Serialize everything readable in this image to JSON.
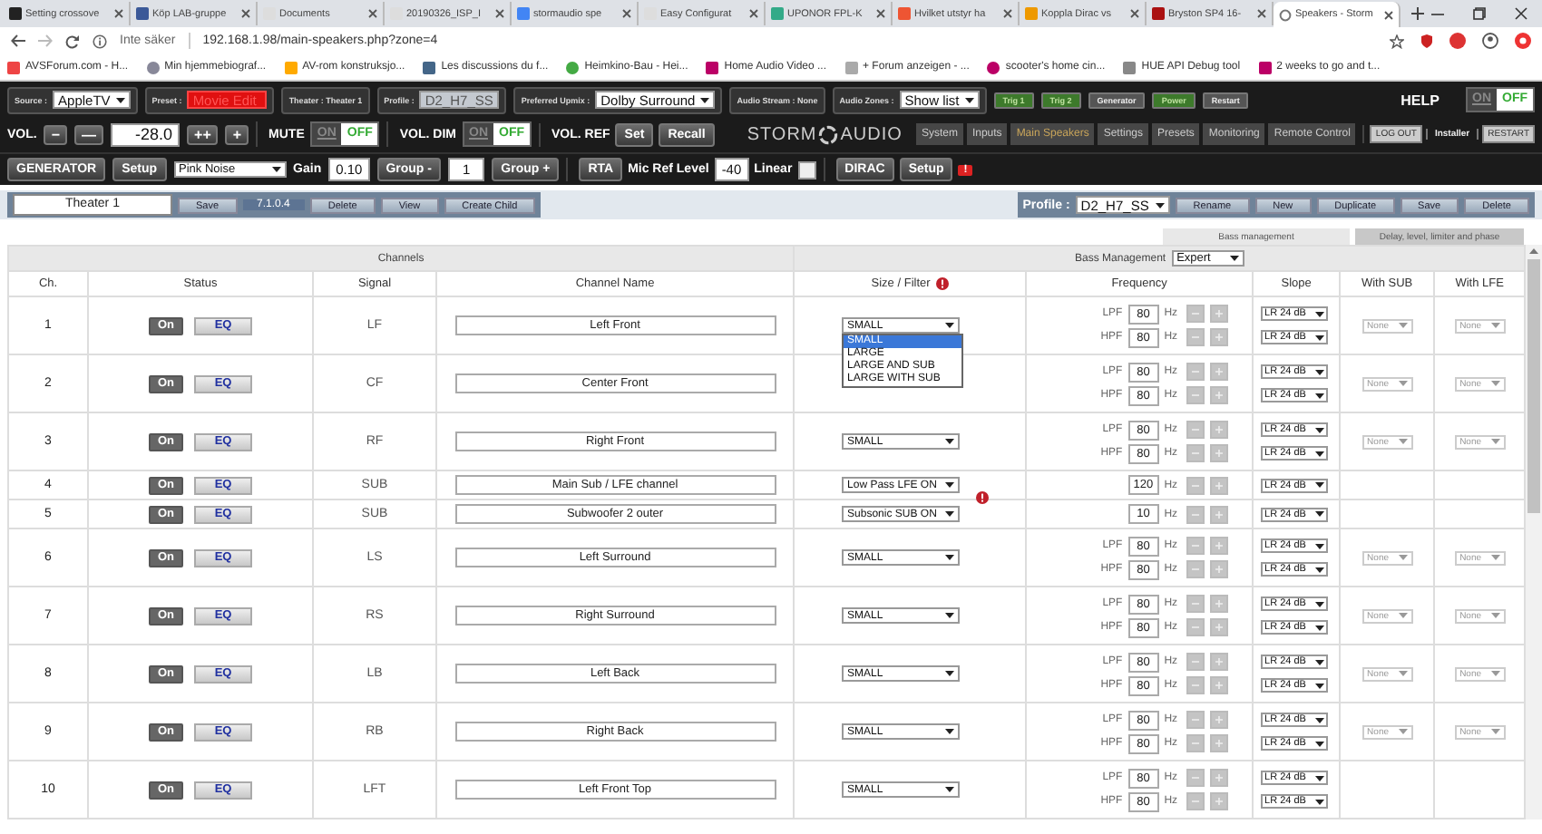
{
  "browser": {
    "tabs": [
      {
        "title": "Setting crossove",
        "selected": false
      },
      {
        "title": "Köp LAB-gruppe",
        "selected": false
      },
      {
        "title": "Documents",
        "selected": false
      },
      {
        "title": "20190326_ISP_I",
        "selected": false
      },
      {
        "title": "stormaudio spe",
        "selected": false
      },
      {
        "title": "Easy Configurat",
        "selected": false
      },
      {
        "title": "UPONOR FPL-K",
        "selected": false
      },
      {
        "title": "Hvilket utstyr ha",
        "selected": false
      },
      {
        "title": "Koppla Dirac vs",
        "selected": false
      },
      {
        "title": "Bryston SP4 16-",
        "selected": false
      },
      {
        "title": "Speakers - Storm",
        "selected": true
      }
    ],
    "address": {
      "security": "Inte säker",
      "url": "192.168.1.98/main-speakers.php?zone=4"
    },
    "bookmarks": [
      "AVSForum.com - H...",
      "Min hjemmebiograf...",
      "AV-rom konstruksjo...",
      "Les discussions du f...",
      "Heimkino-Bau - Hei...",
      "Home Audio Video ...",
      "+ Forum anzeigen - ...",
      "scooter's home cin...",
      "HUE API Debug tool",
      "2 weeks to go and t..."
    ]
  },
  "header": {
    "selectors": [
      {
        "label": "Source :",
        "value": "AppleTV",
        "kind": "select"
      },
      {
        "label": "Preset :",
        "value": "Movie Edit",
        "kind": "alert"
      },
      {
        "label": "Theater : Theater 1",
        "kind": "plain"
      },
      {
        "label": "Profile :",
        "value": "D2_H7_SS",
        "kind": "disabled"
      },
      {
        "label": "Preferred Upmix :",
        "value": "Dolby Surround",
        "kind": "select"
      },
      {
        "label": "Audio Stream : None",
        "kind": "plain"
      },
      {
        "label": "Audio Zones :",
        "value": "Show list",
        "kind": "select"
      }
    ],
    "triggers": [
      {
        "label": "Trig 1",
        "on": true
      },
      {
        "label": "Trig 2",
        "on": true
      },
      {
        "label": "Generator",
        "on": false
      },
      {
        "label": "Power",
        "on": true
      },
      {
        "label": "Restart",
        "on": false
      }
    ],
    "help": {
      "label": "HELP",
      "on_text": "ON",
      "off_text": "OFF",
      "on": false
    }
  },
  "volume": {
    "label": "VOL.",
    "down": [
      "−",
      "—"
    ],
    "value": "-28.0",
    "up": [
      "++",
      "+"
    ]
  },
  "toggles": [
    {
      "label": "MUTE",
      "on_text": "ON",
      "off_text": "OFF",
      "on": false
    },
    {
      "label": "VOL. DIM",
      "on_text": "ON",
      "off_text": "OFF",
      "on": false
    }
  ],
  "vol_ref": {
    "label": "VOL. REF",
    "buttons": [
      "Set",
      "Recall"
    ]
  },
  "logo": {
    "left": "STORM",
    "right": "AUDIO"
  },
  "nav": [
    {
      "label": "System",
      "selected": false
    },
    {
      "label": "Inputs",
      "selected": false
    },
    {
      "label": "Main Speakers",
      "selected": true
    },
    {
      "label": "Settings",
      "selected": false
    },
    {
      "label": "Presets",
      "selected": false
    },
    {
      "label": "Monitoring",
      "selected": false
    },
    {
      "label": "Remote Control",
      "selected": false
    }
  ],
  "session": {
    "logout": "LOG OUT",
    "user": "Installer",
    "restart": "RESTART"
  },
  "generator": {
    "label": "GENERATOR",
    "setup": "Setup",
    "signal": "Pink Noise",
    "gain_label": "Gain",
    "gain": "0.10",
    "group_minus": "Group -",
    "group": "1",
    "group_plus": "Group +"
  },
  "rta": {
    "label": "RTA",
    "mic_label": "Mic Ref Level",
    "mic": "-40",
    "linear_label": "Linear",
    "linear": false
  },
  "dirac": {
    "label": "DIRAC",
    "setup": "Setup",
    "alert": "!"
  },
  "theater_bar": {
    "name": "Theater 1",
    "actions": [
      {
        "label": "Save",
        "kind": "button"
      },
      {
        "label": "7.1.0.4",
        "kind": "info"
      },
      {
        "label": "Delete",
        "kind": "button"
      },
      {
        "label": "View",
        "kind": "button"
      },
      {
        "label": "Create Child",
        "kind": "button"
      }
    ]
  },
  "profile_bar": {
    "label": "Profile :",
    "value": "D2_H7_SS",
    "actions": [
      "Rename",
      "New",
      "Duplicate",
      "Save",
      "Delete"
    ]
  },
  "section_tabs": [
    {
      "label": "Bass management",
      "selected": true
    },
    {
      "label": "Delay, level, limiter and phase",
      "selected": false
    }
  ],
  "table": {
    "group_title": "Channels",
    "bass_label": "Bass Management",
    "bass_mode": "Expert",
    "columns": [
      {
        "label": "Ch."
      },
      {
        "label": "Status"
      },
      {
        "label": "Signal"
      },
      {
        "label": "Channel Name"
      },
      {
        "label": "Size / Filter",
        "warning": true
      },
      {
        "label": "Frequency"
      },
      {
        "label": "Slope"
      },
      {
        "label": "With SUB"
      },
      {
        "label": "With LFE"
      }
    ],
    "rows": [
      {
        "ch": "1",
        "kind": "speaker",
        "on": "On",
        "eq": "EQ",
        "signal": "LF",
        "name": "Left Front",
        "size": "SMALL",
        "options": [
          {
            "label": "SMALL",
            "selected": true
          },
          {
            "label": "LARGE",
            "selected": false
          },
          {
            "label": "LARGE AND SUB",
            "selected": false
          },
          {
            "label": "LARGE WITH SUB",
            "selected": false
          }
        ],
        "filters": [
          {
            "label": "LPF",
            "value": "80",
            "unit": "Hz",
            "slope": "LR 24 dB"
          },
          {
            "label": "HPF",
            "value": "80",
            "unit": "Hz",
            "slope": "LR 24 dB"
          }
        ],
        "with_sub": "None",
        "with_lfe": "None"
      },
      {
        "ch": "2",
        "kind": "speaker",
        "on": "On",
        "eq": "EQ",
        "signal": "CF",
        "name": "Center Front",
        "filters": [
          {
            "label": "LPF",
            "value": "80",
            "unit": "Hz",
            "slope": "LR 24 dB"
          },
          {
            "label": "HPF",
            "value": "80",
            "unit": "Hz",
            "slope": "LR 24 dB"
          }
        ],
        "with_sub": "None",
        "with_lfe": "None"
      },
      {
        "ch": "3",
        "kind": "speaker",
        "on": "On",
        "eq": "EQ",
        "signal": "RF",
        "name": "Right Front",
        "size": "SMALL",
        "filters": [
          {
            "label": "LPF",
            "value": "80",
            "unit": "Hz",
            "slope": "LR 24 dB"
          },
          {
            "label": "HPF",
            "value": "80",
            "unit": "Hz",
            "slope": "LR 24 dB"
          }
        ],
        "with_sub": "None",
        "with_lfe": "None"
      },
      {
        "ch": "4",
        "kind": "sub",
        "on": "On",
        "eq": "EQ",
        "signal": "SUB",
        "name": "Main Sub / LFE channel",
        "size": "Low Pass LFE ON",
        "filters": [
          {
            "value": "120",
            "unit": "Hz",
            "slope": "LR 24 dB"
          }
        ]
      },
      {
        "ch": "5",
        "kind": "sub",
        "on": "On",
        "eq": "EQ",
        "signal": "SUB",
        "name": "Subwoofer 2 outer",
        "size": "Subsonic SUB ON",
        "warning": true,
        "filters": [
          {
            "value": "10",
            "unit": "Hz",
            "slope": "LR 24 dB"
          }
        ]
      },
      {
        "ch": "6",
        "kind": "speaker",
        "on": "On",
        "eq": "EQ",
        "signal": "LS",
        "name": "Left Surround",
        "size": "SMALL",
        "filters": [
          {
            "label": "LPF",
            "value": "80",
            "unit": "Hz",
            "slope": "LR 24 dB"
          },
          {
            "label": "HPF",
            "value": "80",
            "unit": "Hz",
            "slope": "LR 24 dB"
          }
        ],
        "with_sub": "None",
        "with_lfe": "None"
      },
      {
        "ch": "7",
        "kind": "speaker",
        "on": "On",
        "eq": "EQ",
        "signal": "RS",
        "name": "Right Surround",
        "size": "SMALL",
        "filters": [
          {
            "label": "LPF",
            "value": "80",
            "unit": "Hz",
            "slope": "LR 24 dB"
          },
          {
            "label": "HPF",
            "value": "80",
            "unit": "Hz",
            "slope": "LR 24 dB"
          }
        ],
        "with_sub": "None",
        "with_lfe": "None"
      },
      {
        "ch": "8",
        "kind": "speaker",
        "on": "On",
        "eq": "EQ",
        "signal": "LB",
        "name": "Left Back",
        "size": "SMALL",
        "filters": [
          {
            "label": "LPF",
            "value": "80",
            "unit": "Hz",
            "slope": "LR 24 dB"
          },
          {
            "label": "HPF",
            "value": "80",
            "unit": "Hz",
            "slope": "LR 24 dB"
          }
        ],
        "with_sub": "None",
        "with_lfe": "None"
      },
      {
        "ch": "9",
        "kind": "speaker",
        "on": "On",
        "eq": "EQ",
        "signal": "RB",
        "name": "Right Back",
        "size": "SMALL",
        "filters": [
          {
            "label": "LPF",
            "value": "80",
            "unit": "Hz",
            "slope": "LR 24 dB"
          },
          {
            "label": "HPF",
            "value": "80",
            "unit": "Hz",
            "slope": "LR 24 dB"
          }
        ],
        "with_sub": "None",
        "with_lfe": "None"
      },
      {
        "ch": "10",
        "kind": "speaker",
        "on": "On",
        "eq": "EQ",
        "signal": "LFT",
        "name": "Left Front Top",
        "size": "SMALL",
        "filters": [
          {
            "label": "LPF",
            "value": "80",
            "unit": "Hz",
            "slope": "LR 24 dB"
          },
          {
            "label": "HPF",
            "value": "80",
            "unit": "Hz",
            "slope": "LR 24 dB"
          }
        ]
      }
    ]
  }
}
